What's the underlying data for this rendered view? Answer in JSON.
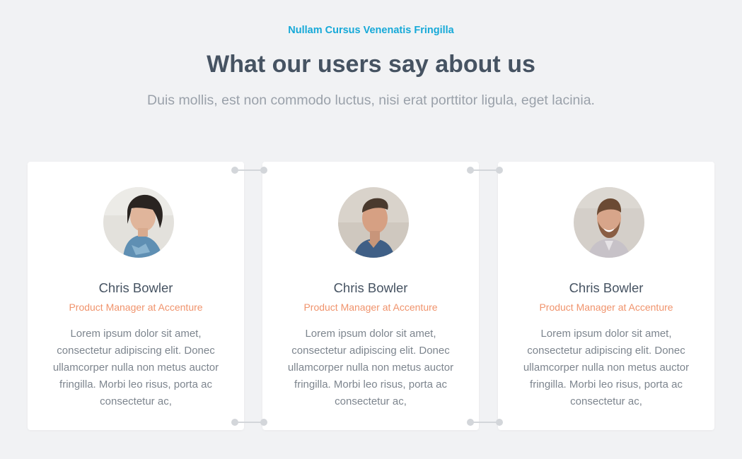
{
  "header": {
    "eyebrow": "Nullam Cursus Venenatis Fringilla",
    "title": "What our users say about us",
    "subtitle": "Duis mollis, est non commodo luctus, nisi erat porttitor ligula, eget lacinia."
  },
  "testimonials": [
    {
      "name": "Chris Bowler",
      "role": "Product Manager at Accenture",
      "quote": "Lorem ipsum dolor sit amet, consectetur adipiscing elit. Donec ullamcorper nulla non metus auctor fringilla. Morbi leo risus, porta ac consectetur ac,",
      "avatar_icon": "woman-portrait-icon"
    },
    {
      "name": "Chris Bowler",
      "role": "Product Manager at Accenture",
      "quote": "Lorem ipsum dolor sit amet, consectetur adipiscing elit. Donec ullamcorper nulla non metus auctor fringilla. Morbi leo risus, porta ac consectetur ac,",
      "avatar_icon": "man-portrait-icon"
    },
    {
      "name": "Chris Bowler",
      "role": "Product Manager at Accenture",
      "quote": "Lorem ipsum dolor sit amet, consectetur adipiscing elit. Donec ullamcorper nulla non metus auctor fringilla. Morbi leo risus, porta ac consectetur ac,",
      "avatar_icon": "bearded-man-portrait-icon"
    }
  ],
  "colors": {
    "accent": "#16a9d8",
    "heading": "#465362",
    "role": "#f0936c",
    "background": "#f1f2f4",
    "connector": "#d3d6da"
  }
}
